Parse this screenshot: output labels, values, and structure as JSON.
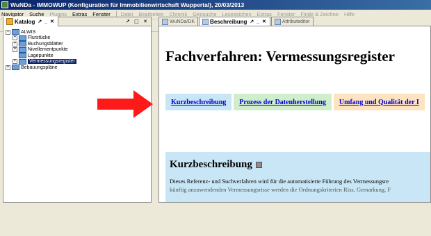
{
  "window": {
    "title": "WuNDa - IMMOWUP (Konfiguration für Immobilienwirtschaft Wuppertal), 20/03/2013"
  },
  "menubar": {
    "items": [
      {
        "label": "Navigator",
        "enabled": true
      },
      {
        "label": "Suche",
        "enabled": true
      },
      {
        "label": "Plugins",
        "enabled": false
      },
      {
        "label": "Extras",
        "enabled": true
      },
      {
        "label": "Fenster",
        "enabled": true
      },
      {
        "label": "Datei",
        "enabled": false
      },
      {
        "label": "Bearbeiten",
        "enabled": false
      },
      {
        "label": "Chronik",
        "enabled": false
      },
      {
        "label": "Geosuche",
        "enabled": false
      },
      {
        "label": "Lesezeichen",
        "enabled": false
      },
      {
        "label": "Extras",
        "enabled": false
      },
      {
        "label": "Fenster",
        "enabled": false
      },
      {
        "label": "Finde & Zeichne",
        "enabled": false
      },
      {
        "label": "Hilfe",
        "enabled": false
      }
    ]
  },
  "toolbar": {
    "icons": [
      "search-icon",
      "refresh-icon"
    ]
  },
  "left_panel": {
    "tab_label": "Katalog",
    "tab_controls": "↗ _ ✕",
    "panel_controls": "↗ □ ✕",
    "tree": {
      "root": "ALWIS",
      "children": [
        "Flurstücke",
        "Buchungsblätter",
        "Nivellementpunkte",
        "Lagepunkte",
        "Vermessungsregister"
      ],
      "selected": "Vermessungsregister",
      "sibling": "Bebauungspläne"
    }
  },
  "right_panel": {
    "tabs": [
      {
        "label": "WuNDa/DK",
        "active": false
      },
      {
        "label": "Beschreibung",
        "active": true
      },
      {
        "label": "Attributeditor",
        "active": false
      }
    ],
    "tab_controls": "↗ _ ✕",
    "page": {
      "title": "Fachverfahren: Vermessungsregister",
      "nav_tabs": [
        "Kurzbeschreibung",
        "Prozess der Datenherstellung",
        "Umfang und Qualität der I"
      ],
      "section_title": "Kurzbeschreibung",
      "section_text": "Dieses Referenz- und Suchverfahren wird für die automatisierte Führung des Vermessungsre",
      "section_text_cut": "künftig anzuwendenden Vermessungsrisse werden die Ordnungskriterien Riss, Gemarkung, F"
    }
  },
  "colors": {
    "accent": "#0a246a",
    "arrow": "#ff1a1a"
  }
}
